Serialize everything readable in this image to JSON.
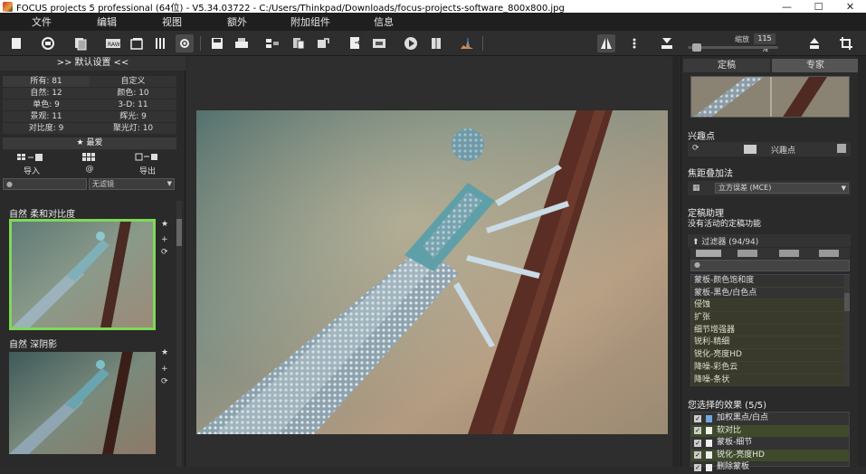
{
  "window": {
    "title": "FOCUS projects 5 professional (64位) - V5.34.03722 - C:/Users/Thinkpad/Downloads/focus-projects-software_800x800.jpg",
    "minimize": "—",
    "maximize": "☐",
    "close": "✕"
  },
  "menu": [
    "文件",
    "编辑",
    "视图",
    "额外",
    "附加组件",
    "信息"
  ],
  "toolbar": {
    "zoom_label": "缩放",
    "zoom_value": "115 %"
  },
  "left": {
    "header": ">> 默认设置 <<",
    "stats": [
      [
        "所有: 81",
        "自定义"
      ],
      [
        "自然: 12",
        "颜色: 10"
      ],
      [
        "单色: 9",
        "3-D: 11"
      ],
      [
        "景观: 11",
        "辉光: 9"
      ],
      [
        "对比度: 9",
        "聚光灯: 10"
      ]
    ],
    "favorites": "★ 最爱",
    "import_label": "导入",
    "at_label": "@",
    "export_label": "导出",
    "filter_placeholder": "",
    "filter_select": "无滤镜",
    "presets": [
      {
        "title": "自然 柔和对比度"
      },
      {
        "title": "自然 深阴影"
      }
    ]
  },
  "right": {
    "tab_focus": "定稿",
    "tab_expert": "专家",
    "interest_points_header": "兴趣点",
    "interest_points_label": "兴趣点",
    "focus_stacking_header": "焦距叠加法",
    "focus_stacking_method": "立方误差 (MCE)",
    "finalize_header": "定稿助理",
    "finalize_text": "没有活动的定稿功能",
    "filters_header": "过滤器 (94/94)",
    "filter_list": [
      "蒙板-颜色饱和度",
      "蒙板-黑色/白色点",
      "侵蚀",
      "扩张",
      "细节增强器",
      "锐利-精细",
      "锐化-亮度HD",
      "降噪-彩色云",
      "降噪-条状"
    ],
    "effects_header": "您选择的效果 (5/5)",
    "effects": [
      "加权黑点/白点",
      "软对比",
      "蒙板-细节",
      "锐化-亮度HD",
      "删除蒙板"
    ]
  },
  "colors": {
    "selection_border": "#7ed957",
    "background": "#2b2b2b"
  }
}
